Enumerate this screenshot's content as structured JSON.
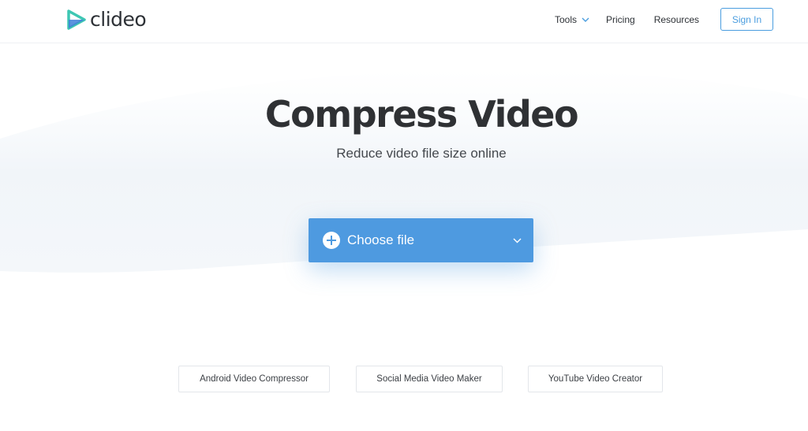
{
  "brand": {
    "name": "clideo"
  },
  "nav": {
    "tools": "Tools",
    "pricing": "Pricing",
    "resources": "Resources",
    "sign_in": "Sign In"
  },
  "hero": {
    "title": "Compress Video",
    "subtitle": "Reduce video file size online",
    "choose_file": "Choose file"
  },
  "related_tools": [
    {
      "label": "Android Video Compressor"
    },
    {
      "label": "Social Media Video Maker"
    },
    {
      "label": "YouTube Video Creator"
    }
  ],
  "colors": {
    "accent": "#4e9ae0",
    "logo_teal": "#3ec7b3",
    "logo_blue": "#3f7fd8",
    "text_dark": "#2f3134"
  }
}
